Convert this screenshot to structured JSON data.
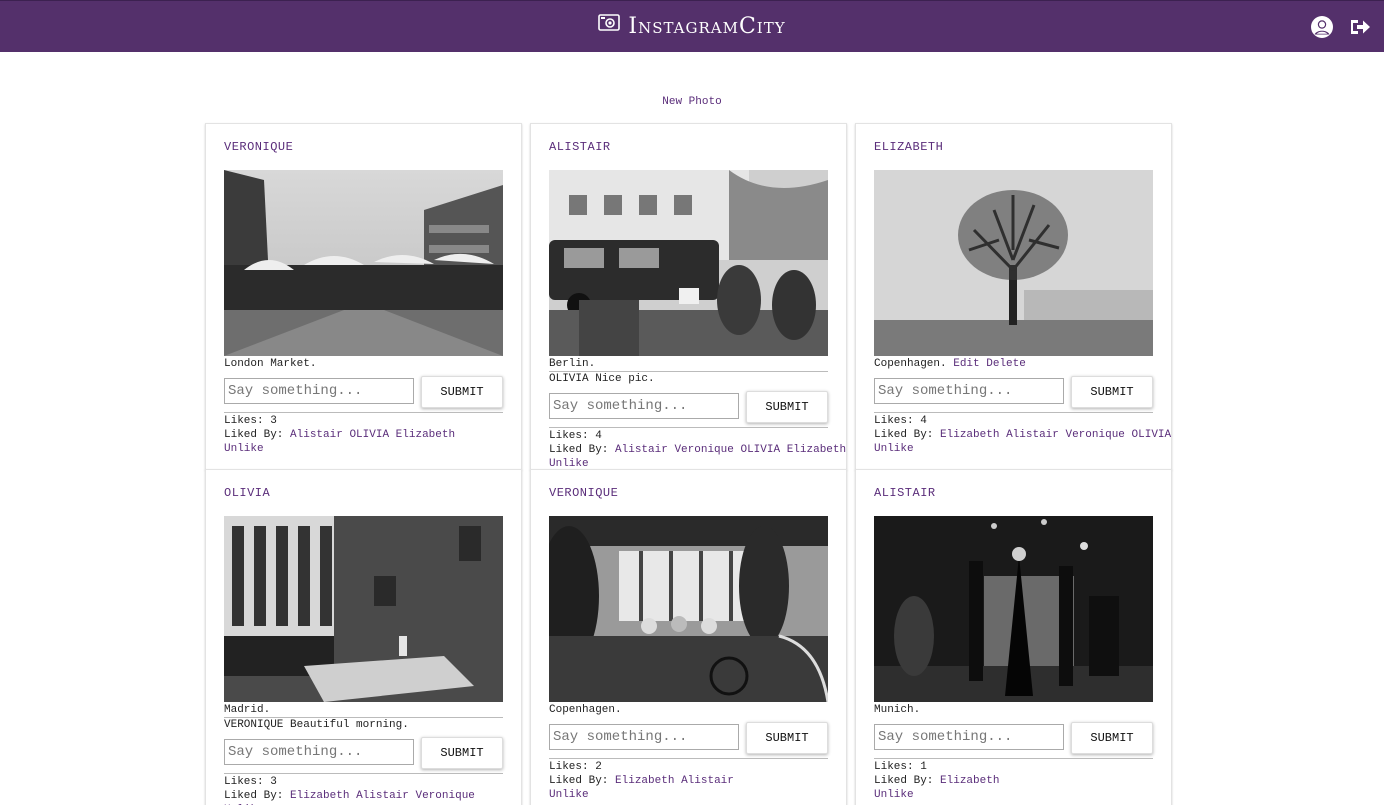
{
  "app": {
    "title": "InstagramCity"
  },
  "nav": {
    "profile_icon": "user-circle-icon",
    "logout_icon": "sign-out-icon"
  },
  "actions": {
    "new_photo": "New Photo"
  },
  "form": {
    "placeholder": "Say something...",
    "submit_label": "SUBMIT"
  },
  "labels": {
    "likes": "Likes:",
    "liked_by": "Liked By:",
    "unlike": "Unlike",
    "edit": "Edit",
    "delete": "Delete"
  },
  "colors": {
    "nav_bg": "#54306b",
    "link": "#5a2d7a"
  },
  "posts": [
    {
      "user": "VERONIQUE",
      "caption": "London Market.",
      "comments": [],
      "likes": "3",
      "liked_by": [
        "Alistair",
        "OLIVIA",
        "Elizabeth"
      ]
    },
    {
      "user": "ALISTAIR",
      "caption": "Berlin.",
      "comments": [
        {
          "author": "OLIVIA",
          "text": "Nice pic."
        }
      ],
      "likes": "4",
      "liked_by": [
        "Alistair",
        "Veronique",
        "OLIVIA",
        "Elizabeth"
      ]
    },
    {
      "user": "ELIZABETH",
      "caption": "Copenhagen.",
      "comments": [],
      "likes": "4",
      "liked_by": [
        "Elizabeth",
        "Alistair",
        "Veronique",
        "OLIVIA"
      ]
    },
    {
      "user": "OLIVIA",
      "caption": "Madrid.",
      "comments": [
        {
          "author": "VERONIQUE",
          "text": "Beautiful morning."
        }
      ],
      "likes": "3",
      "liked_by": [
        "Elizabeth",
        "Alistair",
        "Veronique"
      ]
    },
    {
      "user": "VERONIQUE",
      "caption": "Copenhagen.",
      "comments": [],
      "likes": "2",
      "liked_by": [
        "Elizabeth",
        "Alistair"
      ]
    },
    {
      "user": "ALISTAIR",
      "caption": "Munich.",
      "comments": [],
      "likes": "1",
      "liked_by": [
        "Elizabeth"
      ]
    }
  ]
}
